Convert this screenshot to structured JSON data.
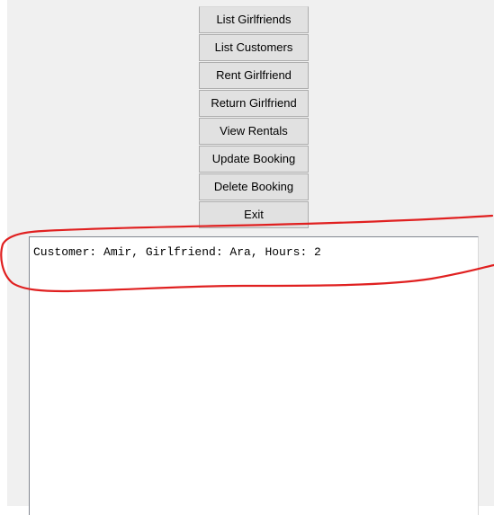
{
  "buttons": [
    {
      "label": "List Girlfriends"
    },
    {
      "label": "List Customers"
    },
    {
      "label": "Rent Girlfriend"
    },
    {
      "label": "Return Girlfriend"
    },
    {
      "label": "View Rentals"
    },
    {
      "label": "Update Booking"
    },
    {
      "label": "Delete Booking"
    },
    {
      "label": "Exit"
    }
  ],
  "output": {
    "lines": [
      "Customer: Amir, Girlfriend: Ara, Hours: 2"
    ]
  },
  "annotation": {
    "color": "#e02020",
    "shape": "hand-drawn-circle"
  }
}
